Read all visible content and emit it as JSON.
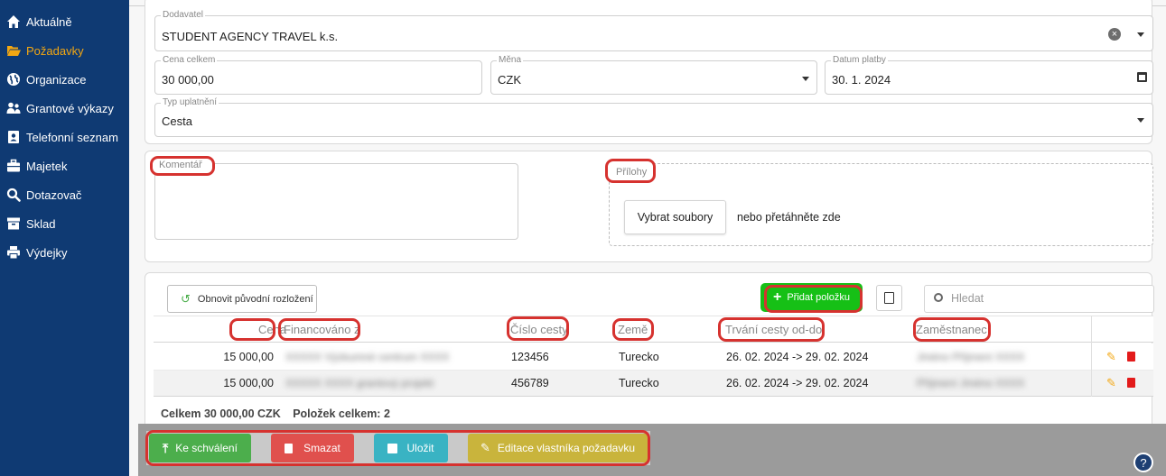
{
  "sidebar": {
    "items": [
      {
        "label": "Aktuálně",
        "icon": "home-icon"
      },
      {
        "label": "Požadavky",
        "icon": "folder-open-icon"
      },
      {
        "label": "Organizace",
        "icon": "globe-icon"
      },
      {
        "label": "Grantové výkazy",
        "icon": "users-icon"
      },
      {
        "label": "Telefonní seznam",
        "icon": "address-book-icon"
      },
      {
        "label": "Majetek",
        "icon": "briefcase-icon"
      },
      {
        "label": "Dotazovač",
        "icon": "search-icon"
      },
      {
        "label": "Sklad",
        "icon": "archive-icon"
      },
      {
        "label": "Výdejky",
        "icon": "print-icon"
      }
    ]
  },
  "form": {
    "supplier_label": "Dodavatel",
    "supplier_value": "STUDENT AGENCY TRAVEL k.s.",
    "price_label": "Cena celkem",
    "price_value": "30 000,00",
    "currency_label": "Měna",
    "currency_value": "CZK",
    "date_label": "Datum platby",
    "date_value": "30. 1. 2024",
    "type_label": "Typ uplatnění",
    "type_value": "Cesta"
  },
  "comment": {
    "label": "Komentář"
  },
  "attachments": {
    "label": "Přílohy",
    "button": "Vybrat soubory",
    "drop_text": "nebo přetáhněte zde"
  },
  "toolbar": {
    "reset_label": "Obnovit původní rozložení",
    "add_label": "Přidat položku",
    "search_placeholder": "Hledat"
  },
  "table": {
    "headers": [
      "Cena",
      "Financováno z",
      "Číslo cesty",
      "Země",
      "Trvání cesty od-do",
      "Zaměstnanec"
    ],
    "rows": [
      {
        "price": "15 000,00",
        "financed": "XXXXX Výzkumné centrum XXXX",
        "trip": "123456",
        "country": "Turecko",
        "duration": "26. 02. 2024 -> 29. 02. 2024",
        "employee": "Jméno Příjmení XXXX"
      },
      {
        "price": "15 000,00",
        "financed": "XXXXX XXXX grantový projekt",
        "trip": "456789",
        "country": "Turecko",
        "duration": "26. 02. 2024 -> 29. 02. 2024",
        "employee": "Příjmení Jméno XXXX"
      }
    ],
    "footer_total": "Celkem 30 000,00 CZK",
    "footer_count": "Položek celkem: 2"
  },
  "actions": {
    "approve": "Ke schválení",
    "delete": "Smazat",
    "save": "Uložit",
    "edit_owner": "Editace vlastníka požadavku"
  },
  "help": {
    "icon": "help-icon"
  },
  "colors": {
    "sidebar": "#0f3a73",
    "active": "#f3a712",
    "approve": "#4cae4c",
    "delete": "#e0504d",
    "save": "#39b3c3",
    "edit": "#c9b43c",
    "add": "#16c016",
    "highlight": "#d6322f"
  }
}
